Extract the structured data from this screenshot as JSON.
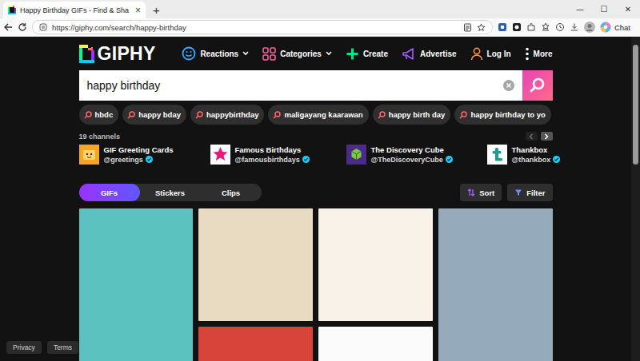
{
  "browser": {
    "tab": {
      "title": "Happy Birthday GIFs - Find & Sha",
      "close": "×",
      "selected": true
    },
    "new_tab": "+",
    "window_controls": [
      "—",
      "☐",
      "✕"
    ],
    "url": "https://giphy.com/search/happy-birthday",
    "chat": "Chat"
  },
  "header": {
    "logo": "GIPHY",
    "nav": [
      {
        "label": "Reactions",
        "dropdown": true,
        "color": "#3ba8ff"
      },
      {
        "label": "Categories",
        "dropdown": true,
        "color": "#ff5fa2"
      },
      {
        "label": "Create",
        "dropdown": false,
        "color": "#00e58a"
      },
      {
        "label": "Advertise",
        "dropdown": false,
        "color": "#a35cff"
      },
      {
        "label": "Log In",
        "dropdown": false,
        "color": "#ff8f3a"
      },
      {
        "label": "More",
        "dropdown": false,
        "color": "#ffffff"
      }
    ]
  },
  "search": {
    "value": "happy birthday"
  },
  "suggestions": [
    "hbdc",
    "happy bday",
    "happybirthday",
    "maligayang kaarawan",
    "happy birth day",
    "happy birthday to yo"
  ],
  "channels": {
    "count": "19 channels",
    "prev_disabled": true,
    "next_disabled": false,
    "items": [
      {
        "name": "GIF Greeting Cards",
        "handle": "@greetings",
        "verified": true
      },
      {
        "name": "Famous Birthdays",
        "handle": "@famousbirthdays",
        "verified": true
      },
      {
        "name": "The Discovery Cube",
        "handle": "@TheDiscoveryCube",
        "verified": true
      },
      {
        "name": "Thankbox",
        "handle": "@thankbox",
        "verified": true
      }
    ]
  },
  "tabs": [
    {
      "label": "GIFs",
      "selected": true
    },
    {
      "label": "Stickers",
      "selected": false
    },
    {
      "label": "Clips",
      "selected": false
    }
  ],
  "toolbar": {
    "sort": "Sort",
    "filter": "Filter"
  },
  "grid": {
    "columns": [
      [
        {
          "color": "#5cc2bf"
        }
      ],
      [
        {
          "color": "#e9dbc2"
        },
        {
          "color": "#d8443a"
        }
      ],
      [
        {
          "color": "#f8f2e8"
        },
        {
          "color": "#fbfbfb"
        }
      ],
      [
        {
          "color": "#95aabb"
        }
      ]
    ]
  },
  "footer": [
    {
      "label": "Privacy"
    },
    {
      "label": "Terms"
    }
  ]
}
